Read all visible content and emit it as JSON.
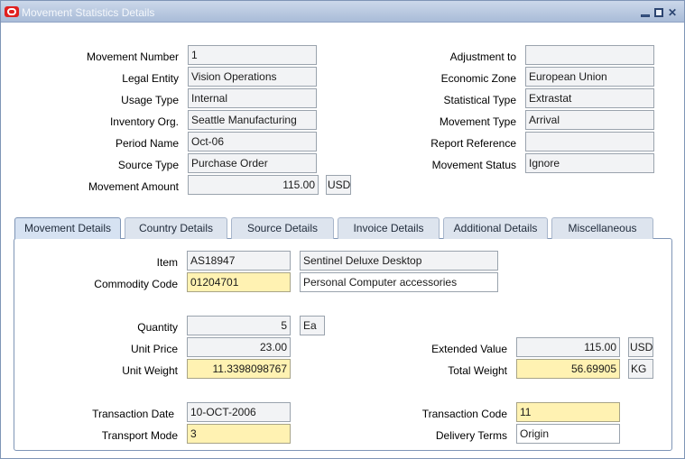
{
  "window": {
    "title": "Movement Statistics Details"
  },
  "header_fields": {
    "movement_number": {
      "label": "Movement Number",
      "value": "1"
    },
    "legal_entity": {
      "label": "Legal Entity",
      "value": "Vision Operations"
    },
    "usage_type": {
      "label": "Usage Type",
      "value": "Internal"
    },
    "inventory_org": {
      "label": "Inventory Org.",
      "value": "Seattle Manufacturing"
    },
    "period_name": {
      "label": "Period Name",
      "value": "Oct-06"
    },
    "source_type": {
      "label": "Source Type",
      "value": "Purchase Order"
    },
    "movement_amount": {
      "label": "Movement Amount",
      "value": "115.00",
      "currency": "USD"
    },
    "adjustment_to": {
      "label": "Adjustment to",
      "value": ""
    },
    "economic_zone": {
      "label": "Economic Zone",
      "value": "European Union"
    },
    "statistical_type": {
      "label": "Statistical Type",
      "value": "Extrastat"
    },
    "movement_type": {
      "label": "Movement Type",
      "value": "Arrival"
    },
    "report_reference": {
      "label": "Report Reference",
      "value": ""
    },
    "movement_status": {
      "label": "Movement Status",
      "value": "Ignore"
    }
  },
  "tabs": [
    {
      "label": "Movement Details",
      "active": true
    },
    {
      "label": "Country Details",
      "active": false
    },
    {
      "label": "Source Details",
      "active": false
    },
    {
      "label": "Invoice Details",
      "active": false
    },
    {
      "label": "Additional Details",
      "active": false
    },
    {
      "label": "Miscellaneous",
      "active": false
    }
  ],
  "movement_details": {
    "item": {
      "label": "Item",
      "value": "AS18947",
      "description": "Sentinel Deluxe Desktop"
    },
    "commodity_code": {
      "label": "Commodity Code",
      "value": "01204701",
      "description": "Personal Computer accessories"
    },
    "quantity": {
      "label": "Quantity",
      "value": "5",
      "uom": "Ea"
    },
    "unit_price": {
      "label": "Unit Price",
      "value": "23.00"
    },
    "unit_weight": {
      "label": "Unit Weight",
      "value": "11.3398098767"
    },
    "extended_value": {
      "label": "Extended Value",
      "value": "115.00",
      "currency": "USD"
    },
    "total_weight": {
      "label": "Total Weight",
      "value": "56.69905",
      "uom": "KG"
    },
    "transaction_date": {
      "label": "Transaction Date",
      "value": "10-OCT-2006"
    },
    "transport_mode": {
      "label": "Transport Mode",
      "value": "3"
    },
    "transaction_code": {
      "label": "Transaction Code",
      "value": "11"
    },
    "delivery_terms": {
      "label": "Delivery Terms",
      "value": "Origin"
    }
  },
  "colors": {
    "required_field": "#fff2b2",
    "readonly_field": "#f2f3f5",
    "titlebar": "#b8c8e0",
    "brand_icon": "#e02020"
  }
}
